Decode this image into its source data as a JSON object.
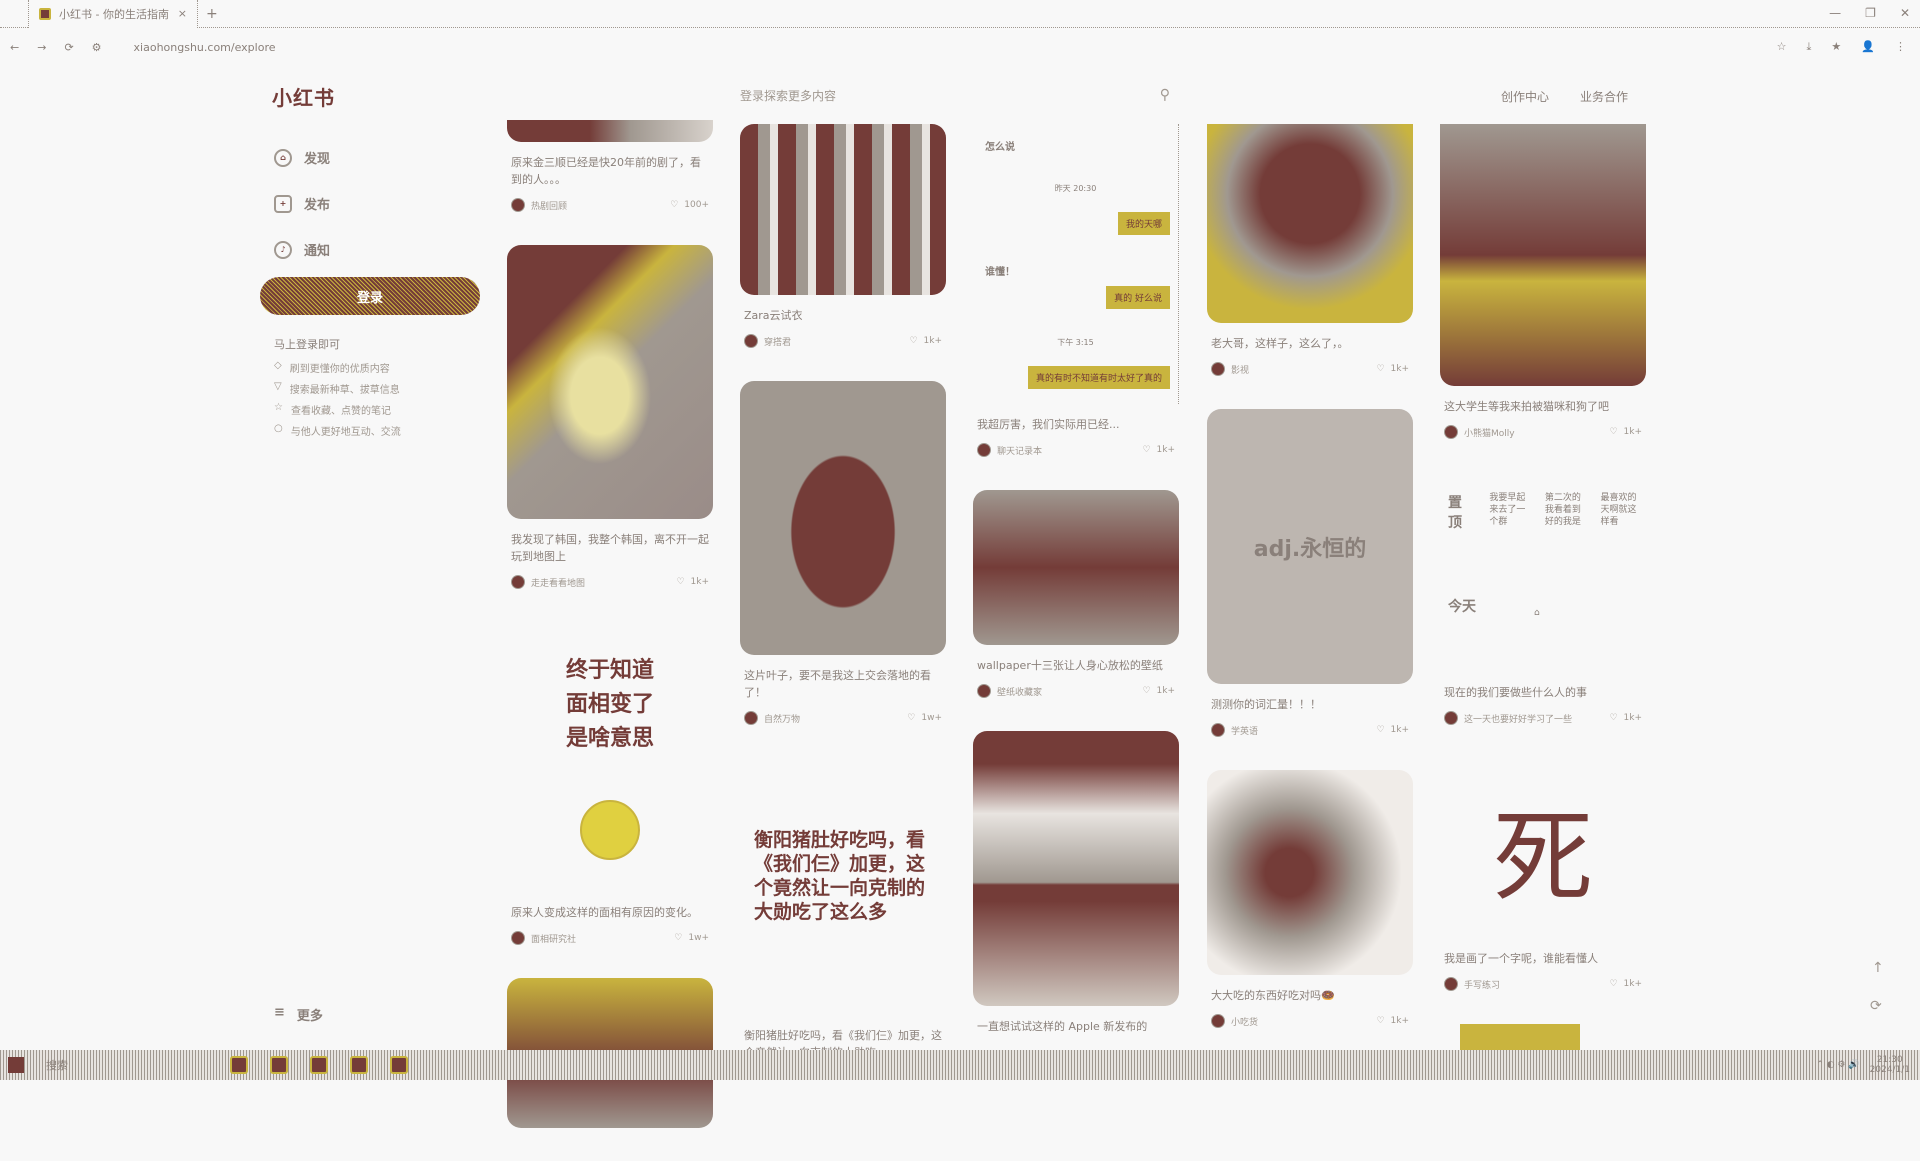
{
  "browser": {
    "tab_title": "小红书 - 你的生活指南",
    "url": "xiaohongshu.com/explore",
    "new_tab": "+",
    "close": "×",
    "nav": [
      "←",
      "→",
      "⟳",
      "⚙"
    ],
    "window": [
      "—",
      "❐",
      "✕"
    ],
    "tools": [
      "☆",
      "⤓",
      "★",
      "👤",
      "⋮"
    ]
  },
  "header": {
    "logo": "小红书",
    "search_placeholder": "登录探索更多内容",
    "search_icon": "⚲",
    "links": [
      "创作中心",
      "业务合作"
    ]
  },
  "sidebar": {
    "items": [
      {
        "label": "发现",
        "icon": "⌂"
      },
      {
        "label": "发布",
        "icon": "+"
      },
      {
        "label": "通知",
        "icon": "♪"
      }
    ],
    "login": "登录",
    "tip_title": "马上登录即可",
    "tips": [
      "刷到更懂你的优质内容",
      "搜索最新种草、拔草信息",
      "查看收藏、点赞的笔记",
      "与他人更好地互动、交流"
    ],
    "more": "更多",
    "more_icon": "≡"
  },
  "columns": [
    [
      {
        "title": "原来金三顺已经是快20年前的剧了，看到的人。。。",
        "author": "热剧回顾",
        "likes": "100+"
      },
      {
        "title": "我发现了韩国，我整个韩国，离不开一起玩到地图上",
        "author": "走走看看地图",
        "likes": "1k+"
      },
      {
        "title": "原来人变成这样的面相有原因的变化。",
        "author": "面相研究社",
        "likes": "1w+",
        "overlay": "终于知道\n面相变了\n是啥意思"
      },
      {
        "title": "",
        "author": "",
        "likes": ""
      }
    ],
    [
      {
        "title": "Zara云试衣",
        "author": "穿搭君",
        "likes": "1k+"
      },
      {
        "title": "这片叶子，要不是我这上交会落地的看了！",
        "author": "自然万物",
        "likes": "1w+"
      },
      {
        "title": "衡阳猪肚好吃吗，看《我们仨》加更，这个竟然让一向克制的大勋吃...",
        "author": "",
        "likes": "",
        "overlay": "衡阳猪肚好吃吗，看《我们仨》加更，这个竟然让一向克制的大勋吃了这么多"
      }
    ],
    [
      {
        "title": "我超厉害，我们实际用已经...",
        "author": "聊天记录本",
        "likes": "1k+",
        "chat": {
          "left": [
            "怎么说",
            "谁懂！"
          ],
          "center": [
            "昨天 20:30",
            "下午 3:15"
          ],
          "bubbles": [
            "我的天哪",
            "真的 好么说",
            "真的有时不知道有时太好了真的"
          ]
        }
      },
      {
        "title": "wallpaper十三张让人身心放松的壁纸",
        "author": "壁纸收藏家",
        "likes": "1k+"
      },
      {
        "title": "一直想试试这样的 Apple 新发布的",
        "author": "",
        "likes": ""
      }
    ],
    [
      {
        "title": "老大哥，这样子，这么了，。",
        "author": "影视",
        "likes": "1k+"
      },
      {
        "title": "测测你的词汇量！！！",
        "author": "学英语",
        "likes": "1k+",
        "overlay": "adj.永恒的"
      },
      {
        "title": "大大吃的东西好吃对吗🍩",
        "author": "小吃货",
        "likes": "1k+"
      }
    ],
    [
      {
        "title": "这大学生等我来拍被猫咪和狗了吧",
        "author": "小熊猫Molly",
        "likes": "1k+"
      },
      {
        "title": "现在的我们要做些什么人的事",
        "author": "这一天也要好好学习了一些",
        "likes": "1k+",
        "calendar": {
          "pinned": "置顶",
          "today": "今天",
          "cells": [
            "我要早起来去了一个群",
            "第二次的我看着到好的我是",
            "最喜欢的天啊就这样看"
          ]
        }
      },
      {
        "title": "我是画了一个字呢，谁能看懂人",
        "author": "手写练习",
        "likes": "1k+",
        "overlay": "死"
      },
      {
        "title": "",
        "author": "",
        "likes": ""
      }
    ]
  ],
  "taskbar": {
    "search": "搜索",
    "time": "21:30",
    "date": "2024/1/1"
  }
}
